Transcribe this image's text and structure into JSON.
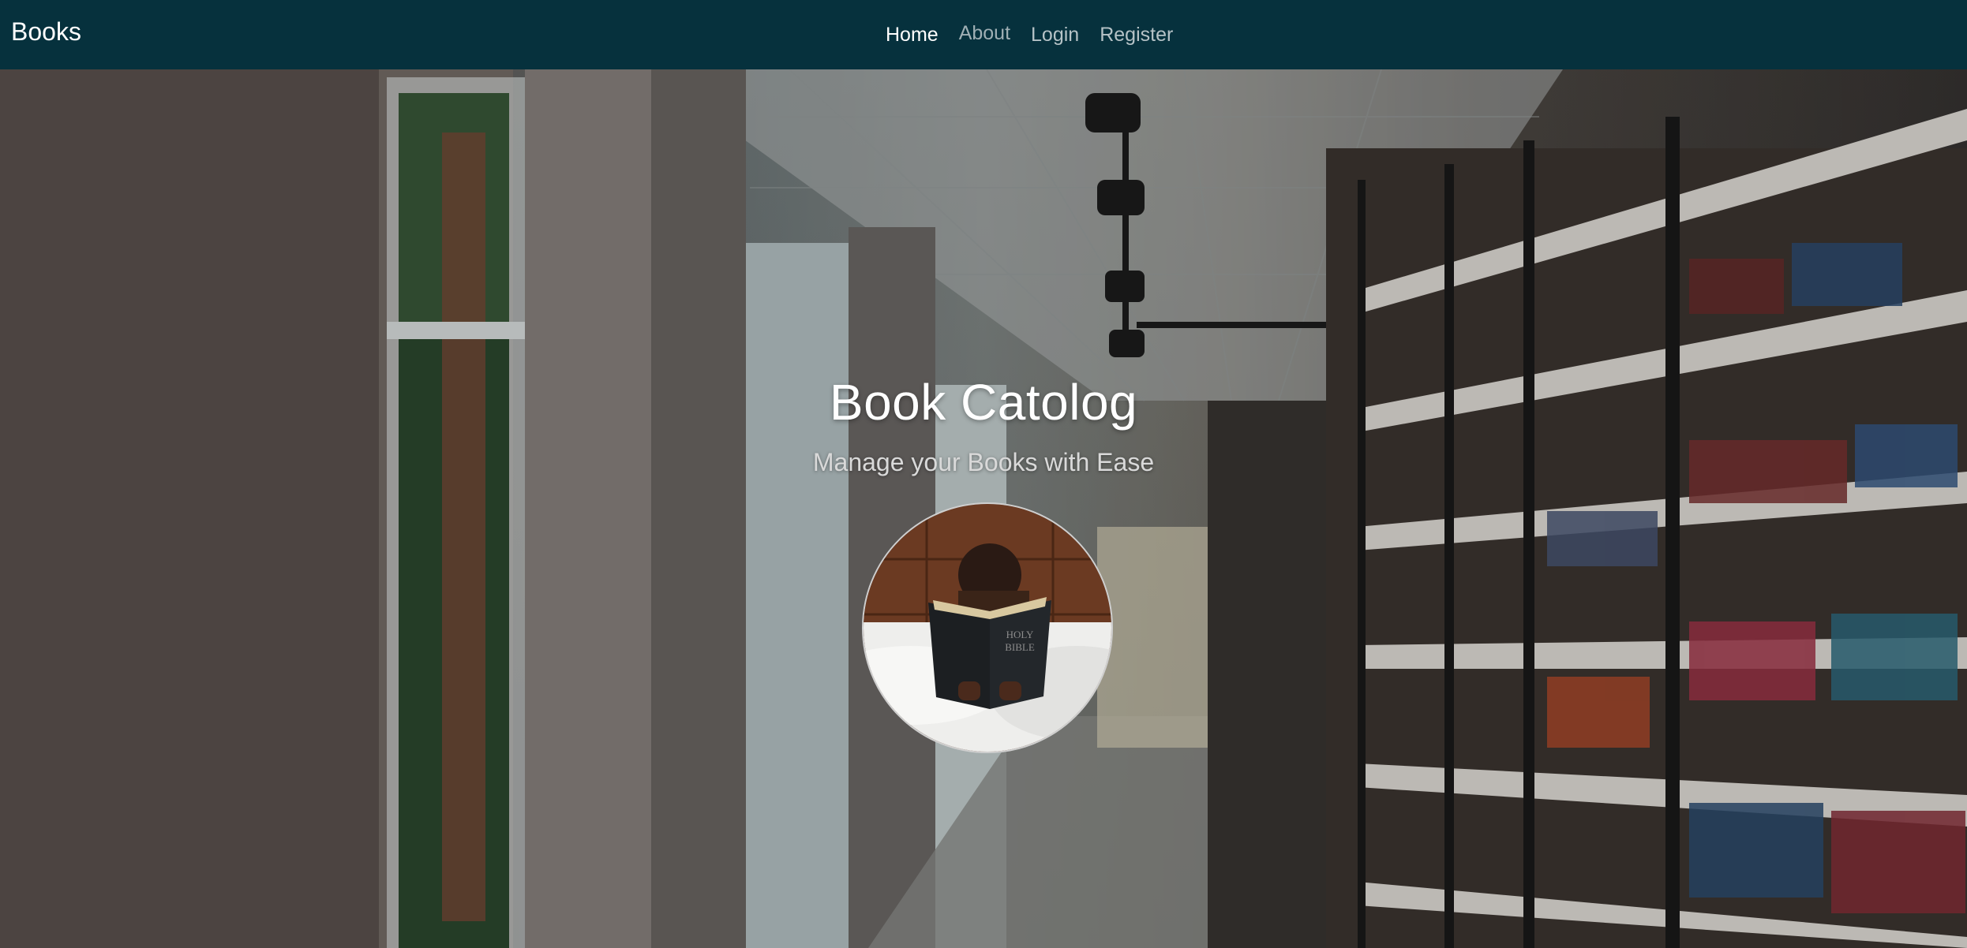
{
  "navbar": {
    "brand": "Books",
    "links": [
      {
        "label": "Home",
        "active": true
      },
      {
        "label": "About",
        "active": false
      },
      {
        "label": "Login",
        "active": false
      },
      {
        "label": "Register",
        "active": false
      }
    ],
    "background": "#06313d"
  },
  "hero": {
    "title": "Book Catolog",
    "subtitle": "Manage your Books with Ease",
    "book_cover_text": "HOLY BIBLE"
  }
}
